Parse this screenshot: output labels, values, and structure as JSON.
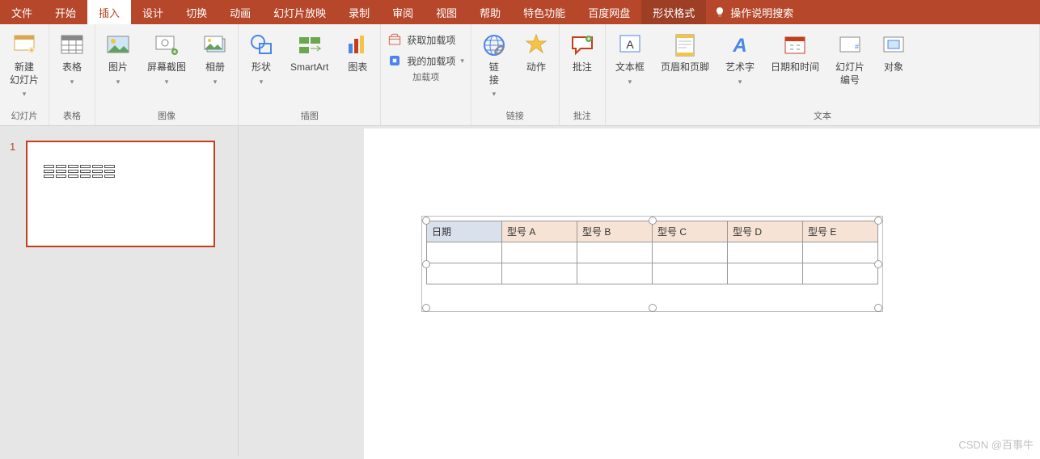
{
  "tabs": [
    "文件",
    "开始",
    "插入",
    "设计",
    "切换",
    "动画",
    "幻灯片放映",
    "录制",
    "审阅",
    "视图",
    "帮助",
    "特色功能",
    "百度网盘",
    "形状格式"
  ],
  "active_tab_index": 2,
  "dark_tab_index": 13,
  "search_placeholder": "操作说明搜索",
  "ribbon": {
    "groups": [
      {
        "label": "幻灯片",
        "items": [
          {
            "name": "new-slide",
            "label": "新建\n幻灯片",
            "dd": true
          }
        ]
      },
      {
        "label": "表格",
        "items": [
          {
            "name": "table",
            "label": "表格",
            "dd": true
          }
        ]
      },
      {
        "label": "图像",
        "items": [
          {
            "name": "picture",
            "label": "图片",
            "dd": true
          },
          {
            "name": "screenshot",
            "label": "屏幕截图",
            "dd": true
          },
          {
            "name": "photo-album",
            "label": "相册",
            "dd": true
          }
        ]
      },
      {
        "label": "插图",
        "items": [
          {
            "name": "shapes",
            "label": "形状",
            "dd": true
          },
          {
            "name": "smartart",
            "label": "SmartArt"
          },
          {
            "name": "chart",
            "label": "图表"
          }
        ]
      },
      {
        "label": "加载项",
        "rows": [
          {
            "name": "get-addins",
            "label": "获取加载项"
          },
          {
            "name": "my-addins",
            "label": "我的加载项",
            "dd": true
          }
        ]
      },
      {
        "label": "链接",
        "items": [
          {
            "name": "link",
            "label": "链\n接",
            "dd": true
          },
          {
            "name": "action",
            "label": "动作"
          }
        ]
      },
      {
        "label": "批注",
        "items": [
          {
            "name": "comment",
            "label": "批注"
          }
        ]
      },
      {
        "label": "文本",
        "items": [
          {
            "name": "textbox",
            "label": "文本框",
            "dd": true
          },
          {
            "name": "header-footer",
            "label": "页眉和页脚"
          },
          {
            "name": "wordart",
            "label": "艺术字",
            "dd": true
          },
          {
            "name": "date-time",
            "label": "日期和时间"
          },
          {
            "name": "slide-number",
            "label": "幻灯片\n编号"
          },
          {
            "name": "object",
            "label": "对象"
          }
        ]
      }
    ]
  },
  "slides": [
    {
      "number": "1"
    }
  ],
  "table": {
    "headers": [
      "日期",
      "型号 A",
      "型号 B",
      "型号 C",
      "型号 D",
      "型号 E"
    ],
    "rows": 3
  },
  "watermark": "CSDN @百事牛"
}
